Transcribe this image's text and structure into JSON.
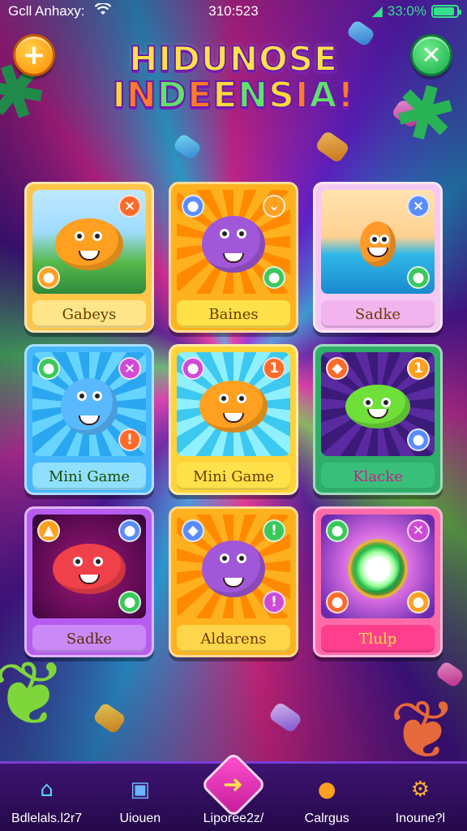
{
  "status_bar": {
    "carrier": "Gcll Anhaxy:",
    "time": "310:523",
    "battery_text": "33:0%",
    "battery_level": 0.9
  },
  "header": {
    "add_button_icon": "plus-icon",
    "close_button_icon": "close-icon",
    "title_line1": "HIDUNOSE",
    "title_line2": "INDEENSIA!"
  },
  "games": [
    {
      "label": "Gabeys",
      "scene": "jungle",
      "creature": "orange-fish-creature",
      "frame_color": "#ffc64a",
      "label_bg": "#ffe58a",
      "label_color": "#6b3a00",
      "badges": {
        "tr": "×",
        "bl": "●"
      }
    },
    {
      "label": "Baines",
      "scene": "sunburst-orange",
      "creature": "purple-creature",
      "frame_color": "#ffb21e",
      "label_bg": "#ffe14a",
      "label_color": "#6b3a00",
      "badges": {
        "tr": "⌄",
        "tl": "●",
        "br": "●"
      }
    },
    {
      "label": "Sadke",
      "scene": "beach",
      "creature": "orange-deer-creature",
      "frame_color": "#f6c9f2",
      "label_bg": "#f2b4ef",
      "label_color": "#6b3a00",
      "badges": {
        "tr": "×",
        "br": "●"
      }
    },
    {
      "label": "Mini Game",
      "scene": "sunburst-blue",
      "creature": "blue-bear-creature",
      "frame_color": "#47b8ff",
      "label_bg": "#8fe0ff",
      "label_color": "#1a4a00",
      "badges": {
        "tl": "●",
        "tr": "×",
        "br": "!"
      }
    },
    {
      "label": "Mini Game",
      "scene": "sunburst-cyan",
      "creature": "orange-fish-creature",
      "frame_color": "#ffd33a",
      "label_bg": "#ffe14a",
      "label_color": "#6b3a00",
      "badges": {
        "tl": "●",
        "tr": "1"
      }
    },
    {
      "label": "Klacke",
      "scene": "sunburst-purple",
      "creature": "green-leaf-creature",
      "frame_color": "#2fae6a",
      "label_bg": "#38c07a",
      "label_color": "#c8208a",
      "badges": {
        "tl": "◆",
        "tr": "1",
        "br": "●"
      }
    },
    {
      "label": "Sadke",
      "scene": "dark-magenta",
      "creature": "red-fish-creature",
      "frame_color": "#b65cf0",
      "label_bg": "#c98af7",
      "label_color": "#5a2a00",
      "badges": {
        "tl": "▲",
        "tr": "●",
        "br": "●"
      }
    },
    {
      "label": "Aldarens",
      "scene": "sunburst-orange",
      "creature": "purple-creature",
      "frame_color": "#ffb21e",
      "label_bg": "#ffd64a",
      "label_color": "#6b3a00",
      "badges": {
        "tl": "◆",
        "tr": "!",
        "br": "!"
      }
    },
    {
      "label": "Tlulp",
      "scene": "sparkle-pink",
      "creature": "green-ring",
      "frame_color": "#ff6ba8",
      "label_bg": "#ff3f8e",
      "label_color": "#ffe04a",
      "badges": {
        "tl": "●",
        "tr": "✕",
        "bl": "●",
        "br": "●"
      }
    }
  ],
  "bottom_nav": [
    {
      "label": "Bdlelals.l2r7",
      "icon": "home-icon",
      "glyph": "⌂",
      "active": false
    },
    {
      "label": "Uiouen",
      "icon": "card-icon",
      "glyph": "▣",
      "active": false
    },
    {
      "label": "Liporee2z/",
      "icon": "arrow-right-icon",
      "glyph": "➜",
      "active": true
    },
    {
      "label": "Calrgus",
      "icon": "duck-icon",
      "glyph": "●",
      "active": false
    },
    {
      "label": "Inoune?l",
      "icon": "gear-icon",
      "glyph": "⚙",
      "active": false
    }
  ]
}
